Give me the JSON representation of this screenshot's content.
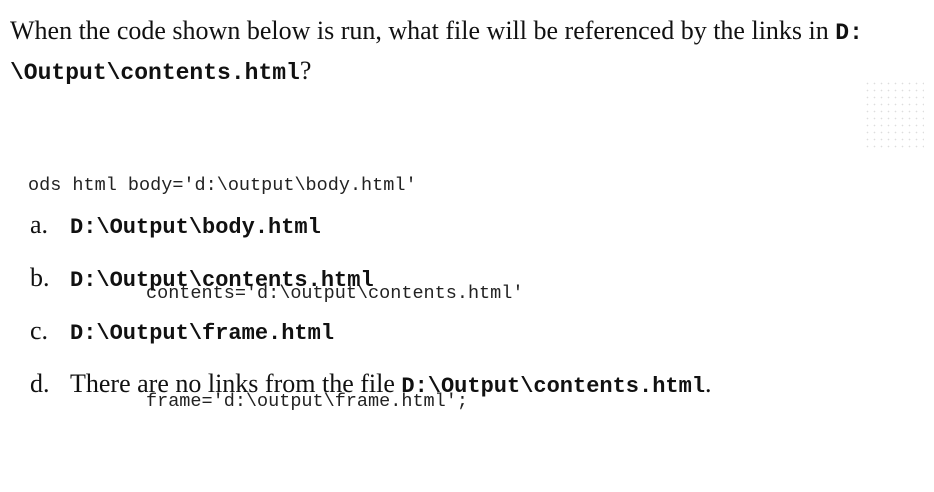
{
  "question": {
    "text_before": "When the code shown below is run, what file will be referenced by the links in ",
    "inline_path_part1": "D:",
    "inline_path_part2": "\\Output\\contents.html",
    "text_after": "?"
  },
  "code": {
    "line1": "ods html body='d:\\output\\body.html'",
    "line2": "contents='d:\\output\\contents.html'",
    "line3": "frame='d:\\output\\frame.html';"
  },
  "options": [
    {
      "letter": "a.",
      "prefix": "",
      "code": "D:\\Output\\body.html",
      "suffix": ""
    },
    {
      "letter": "b.",
      "prefix": "",
      "code": "D:\\Output\\contents.html",
      "suffix": ""
    },
    {
      "letter": "c.",
      "prefix": "",
      "code": "D:\\Output\\frame.html",
      "suffix": ""
    },
    {
      "letter": "d.",
      "prefix": "There are no links from the file ",
      "code": "D:\\Output\\contents.html",
      "suffix": "."
    }
  ]
}
